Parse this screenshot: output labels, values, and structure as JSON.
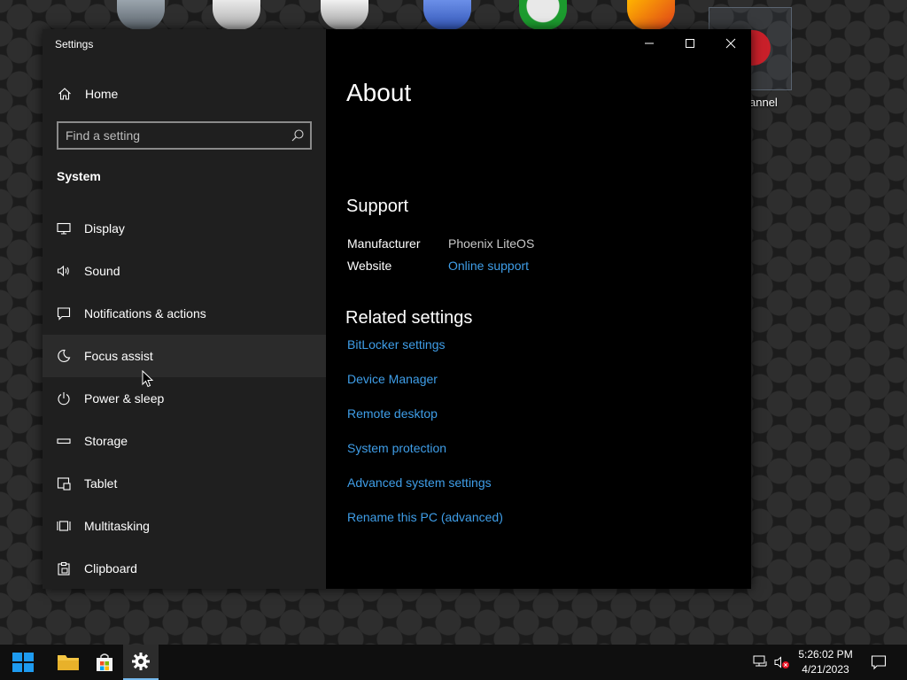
{
  "desktop": {
    "visible_label": "annel"
  },
  "window": {
    "title": "Settings"
  },
  "sidebar": {
    "home_label": "Home",
    "search_placeholder": "Find a setting",
    "section_title": "System",
    "items": [
      {
        "label": "Display",
        "icon": "monitor-icon"
      },
      {
        "label": "Sound",
        "icon": "speaker-icon"
      },
      {
        "label": "Notifications & actions",
        "icon": "notification-icon"
      },
      {
        "label": "Focus assist",
        "icon": "moon-icon"
      },
      {
        "label": "Power & sleep",
        "icon": "power-icon"
      },
      {
        "label": "Storage",
        "icon": "storage-icon"
      },
      {
        "label": "Tablet",
        "icon": "tablet-icon"
      },
      {
        "label": "Multitasking",
        "icon": "multitasking-icon"
      },
      {
        "label": "Clipboard",
        "icon": "clipboard-icon"
      }
    ]
  },
  "main": {
    "title": "About",
    "support": {
      "heading": "Support",
      "manufacturer_label": "Manufacturer",
      "manufacturer_value": "Phoenix LiteOS",
      "website_label": "Website",
      "website_link": "Online support"
    },
    "related": {
      "heading": "Related settings",
      "links": [
        "BitLocker settings",
        "Device Manager",
        "Remote desktop",
        "System protection",
        "Advanced system settings",
        "Rename this PC (advanced)"
      ]
    }
  },
  "taskbar": {
    "time": "5:26:02 PM",
    "date": "4/21/2023"
  },
  "colors": {
    "link": "#3f9ee8",
    "sidebar_bg": "#1f1f1f",
    "main_bg": "#000000",
    "hover_bg": "#2b2b2b",
    "accent": "#76b9ed"
  }
}
